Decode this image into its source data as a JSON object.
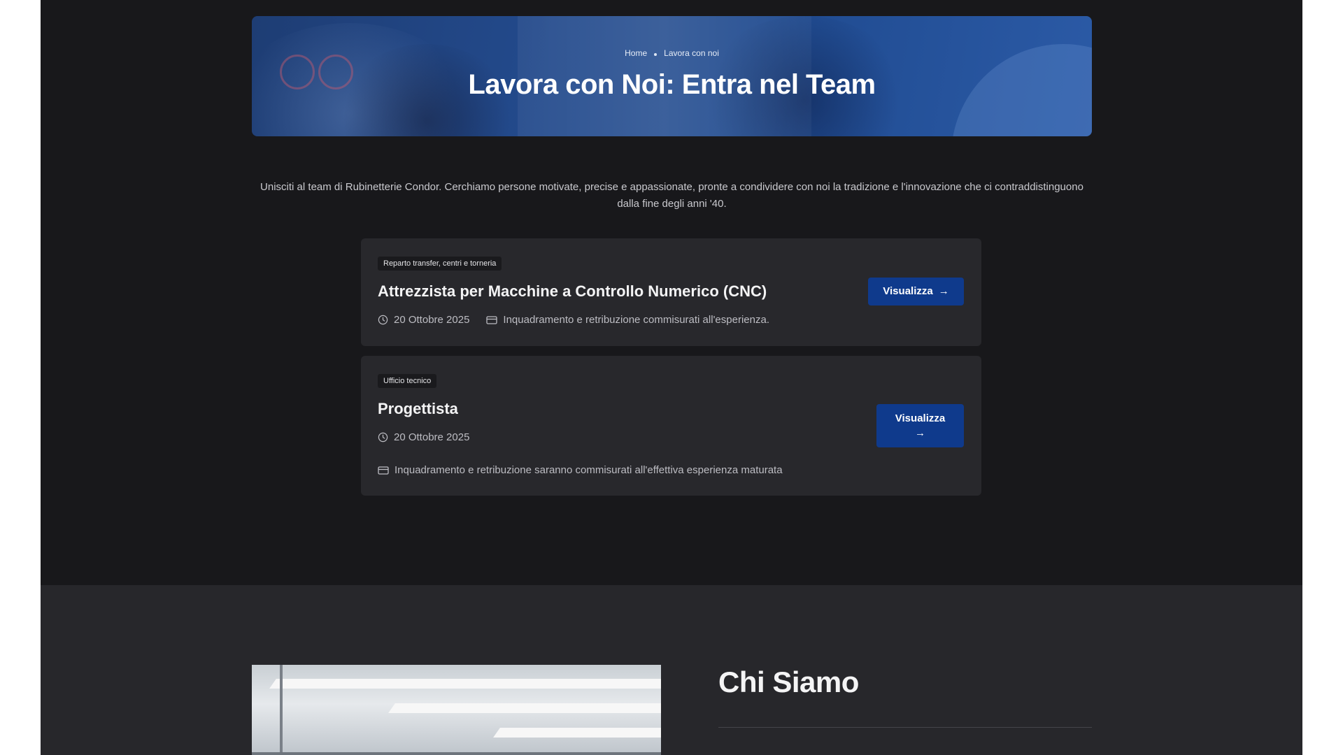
{
  "hero": {
    "breadcrumb": [
      "Home",
      "Lavora con noi"
    ],
    "title": "Lavora con Noi: Entra nel Team"
  },
  "intro": "Unisciti al team di Rubinetterie Condor. Cerchiamo persone motivate, precise e appassionate, pronte a condividere con noi la tradizione e l'innovazione che ci contraddistinguono dalla fine degli anni '40.",
  "jobs": [
    {
      "tag": "Reparto transfer, centri e torneria",
      "title": "Attrezzista per Macchine a Controllo Numerico (CNC)",
      "date": "20 Ottobre 2025",
      "salary": "Inquadramento e retribuzione commisurati all'esperienza.",
      "button": "Visualizza",
      "button_arrow": "→"
    },
    {
      "tag": "Ufficio tecnico",
      "title": "Progettista",
      "date": "20 Ottobre 2025",
      "salary": "Inquadramento e retribuzione saranno commisurati all'effettiva esperienza maturata",
      "button": "Visualizza",
      "button_arrow": "→"
    }
  ],
  "about": {
    "title": "Chi Siamo"
  },
  "colors": {
    "page_bg": "#18181b",
    "card_bg": "#28282c",
    "accent": "#0f3a8c",
    "hero_blue": "#234a8c"
  },
  "icons": {
    "date": "clock-icon",
    "salary": "wallet-icon",
    "button": "arrow-right-icon"
  }
}
